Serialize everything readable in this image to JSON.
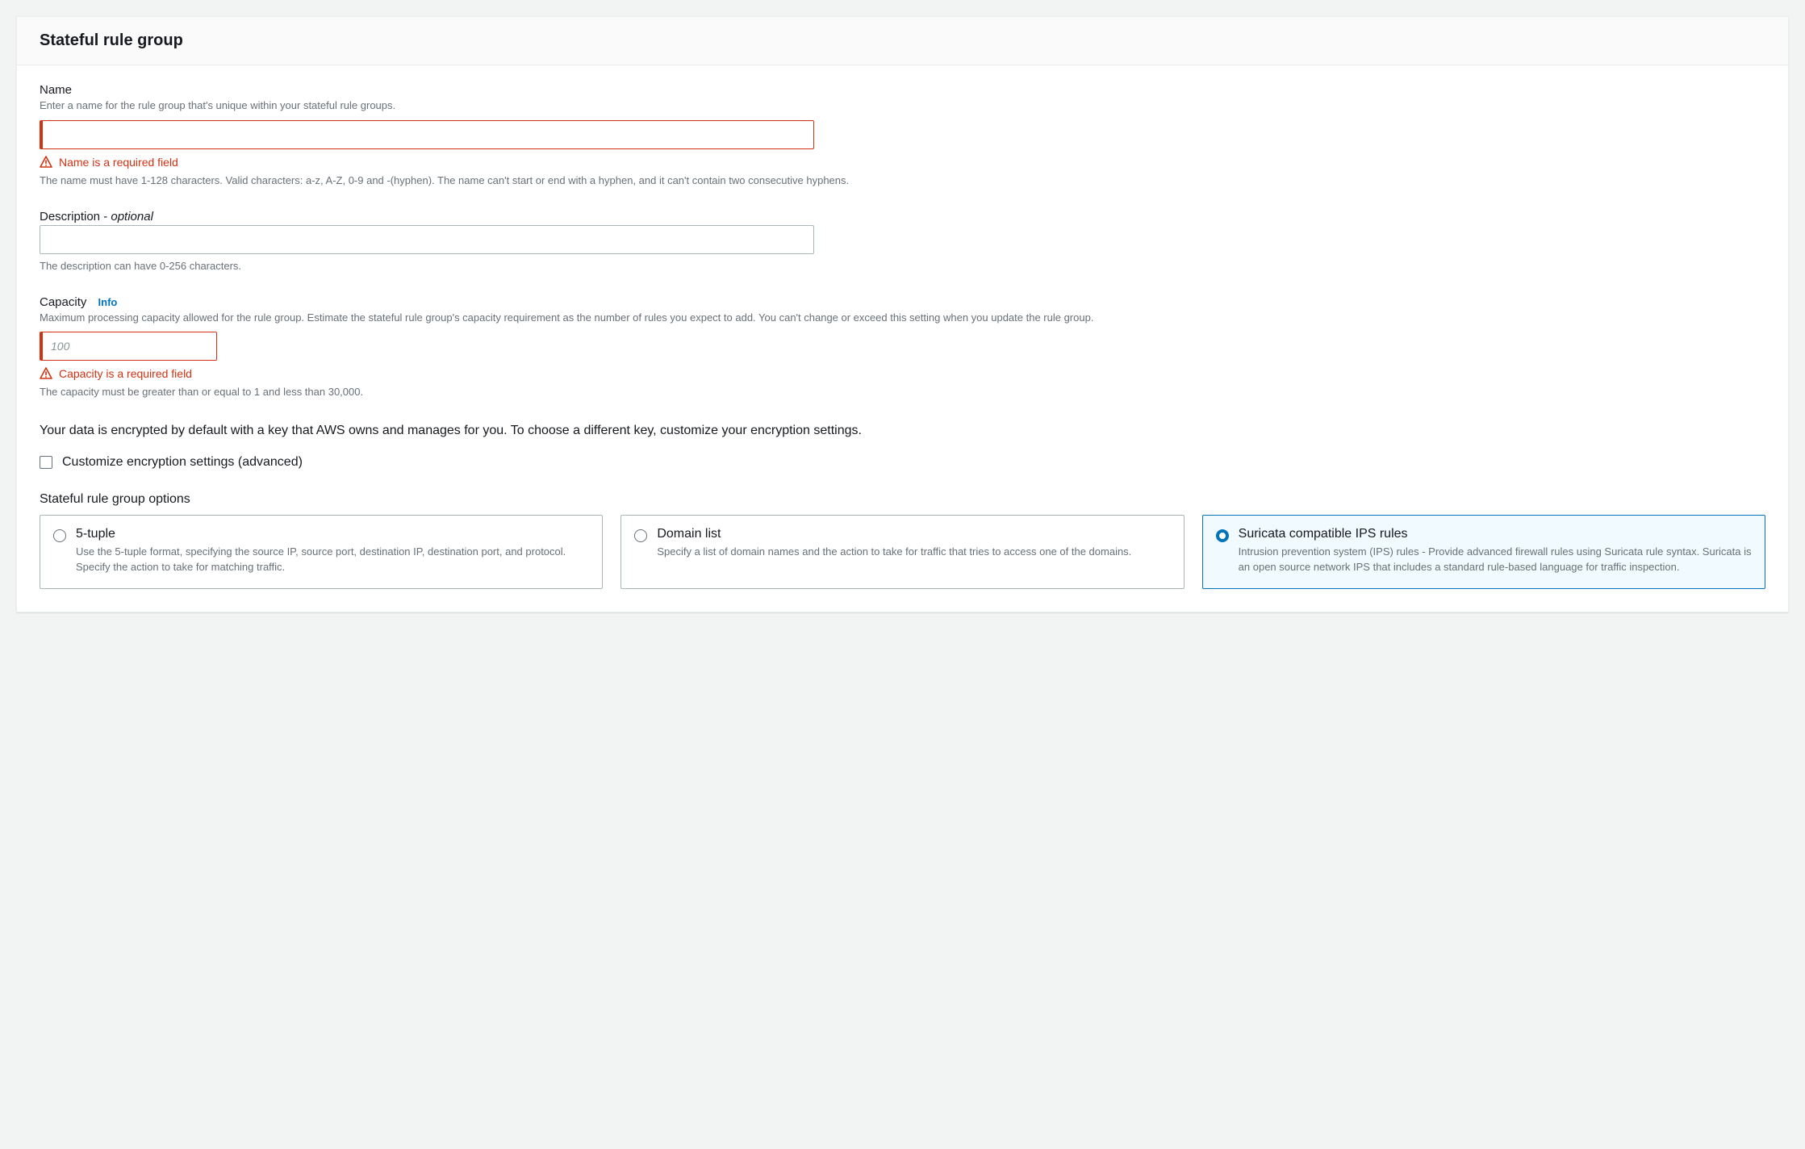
{
  "panel": {
    "title": "Stateful rule group"
  },
  "name_field": {
    "label": "Name",
    "hint": "Enter a name for the rule group that's unique within your stateful rule groups.",
    "value": "",
    "error": "Name is a required field",
    "constraint": "The name must have 1-128 characters. Valid characters: a-z, A-Z, 0-9 and -(hyphen). The name can't start or end with a hyphen, and it can't contain two consecutive hyphens."
  },
  "description_field": {
    "label_main": "Description - ",
    "label_optional": "optional",
    "value": "",
    "constraint": "The description can have 0-256 characters."
  },
  "capacity_field": {
    "label": "Capacity",
    "info_label": "Info",
    "hint": "Maximum processing capacity allowed for the rule group. Estimate the stateful rule group's capacity requirement as the number of rules you expect to add. You can't change or exceed this setting when you update the rule group.",
    "placeholder": "100",
    "value": "",
    "error": "Capacity is a required field",
    "constraint": "The capacity must be greater than or equal to 1 and less than 30,000."
  },
  "encryption": {
    "text": "Your data is encrypted by default with a key that AWS owns and manages for you. To choose a different key, customize your encryption settings.",
    "checkbox_label": "Customize encryption settings (advanced)",
    "checked": false
  },
  "options": {
    "label": "Stateful rule group options",
    "items": [
      {
        "title": "5-tuple",
        "desc": "Use the 5-tuple format, specifying the source IP, source port, destination IP, destination port, and protocol. Specify the action to take for matching traffic.",
        "selected": false
      },
      {
        "title": "Domain list",
        "desc": "Specify a list of domain names and the action to take for traffic that tries to access one of the domains.",
        "selected": false
      },
      {
        "title": "Suricata compatible IPS rules",
        "desc": "Intrusion prevention system (IPS) rules - Provide advanced firewall rules using Suricata rule syntax. Suricata is an open source network IPS that includes a standard rule-based language for traffic inspection.",
        "selected": true
      }
    ]
  }
}
